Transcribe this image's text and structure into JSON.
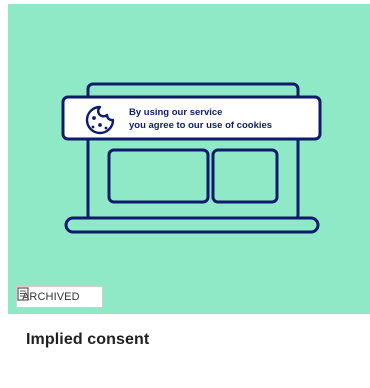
{
  "banner": {
    "line1": "By using our service",
    "line2": "you agree to our use of cookies"
  },
  "badge": {
    "label": "ARCHIVED",
    "icon": "archive-box-icon"
  },
  "card": {
    "title": "Implied consent"
  },
  "colors": {
    "hero_background": "#8fe8c6",
    "outline": "#0e1b6b"
  }
}
